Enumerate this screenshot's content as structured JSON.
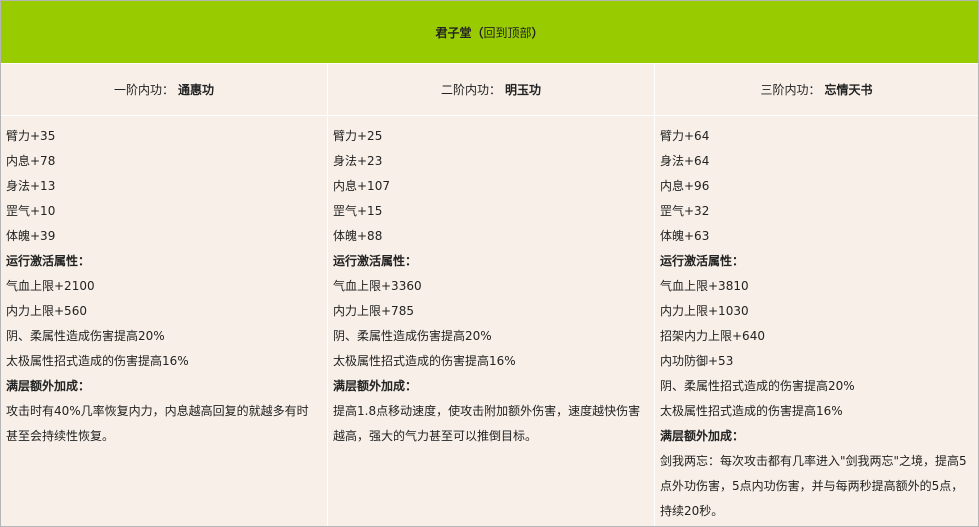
{
  "header": {
    "title": "君子堂",
    "link_open": "（",
    "link_text": "回到顶部",
    "link_close": "）"
  },
  "columns": [
    {
      "tier_label": "一阶内功：",
      "skill_name": "通惠功",
      "stats": [
        "臂力+35",
        "内息+78",
        "身法+13",
        "罡气+10",
        "体魄+39"
      ],
      "run_title": "运行激活属性：",
      "run_attrs": [
        "气血上限+2100",
        "内力上限+560",
        "阴、柔属性造成伤害提高20%",
        "太极属性招式造成的伤害提高16%"
      ],
      "bonus_title": "满层额外加成：",
      "bonus_text": "攻击时有40%几率恢复内力，内息越高回复的就越多有时甚至会持续性恢复。"
    },
    {
      "tier_label": "二阶内功：",
      "skill_name": "明玉功",
      "stats": [
        "臂力+25",
        "身法+23",
        "内息+107",
        "罡气+15",
        "体魄+88"
      ],
      "run_title": "运行激活属性：",
      "run_attrs": [
        "气血上限+3360",
        "内力上限+785",
        "阴、柔属性造成伤害提高20%",
        "太极属性招式造成的伤害提高16%"
      ],
      "bonus_title": "满层额外加成：",
      "bonus_text": "提高1.8点移动速度，使攻击附加额外伤害，速度越快伤害越高，强大的气力甚至可以推倒目标。"
    },
    {
      "tier_label": "三阶内功：",
      "skill_name": "忘情天书",
      "stats": [
        "臂力+64",
        "身法+64",
        "内息+96",
        "罡气+32",
        "体魄+63"
      ],
      "run_title": "运行激活属性：",
      "run_attrs": [
        "气血上限+3810",
        "内力上限+1030",
        "招架内力上限+640",
        "内功防御+53",
        "阴、柔属性招式造成的伤害提高20%",
        "太极属性招式造成的伤害提高16%"
      ],
      "bonus_title": "满层额外加成：",
      "bonus_text": "剑我两忘：每次攻击都有几率进入\"剑我两忘\"之境，提高5点外功伤害，5点内功伤害，并与每两秒提高额外的5点，持续20秒。"
    }
  ]
}
